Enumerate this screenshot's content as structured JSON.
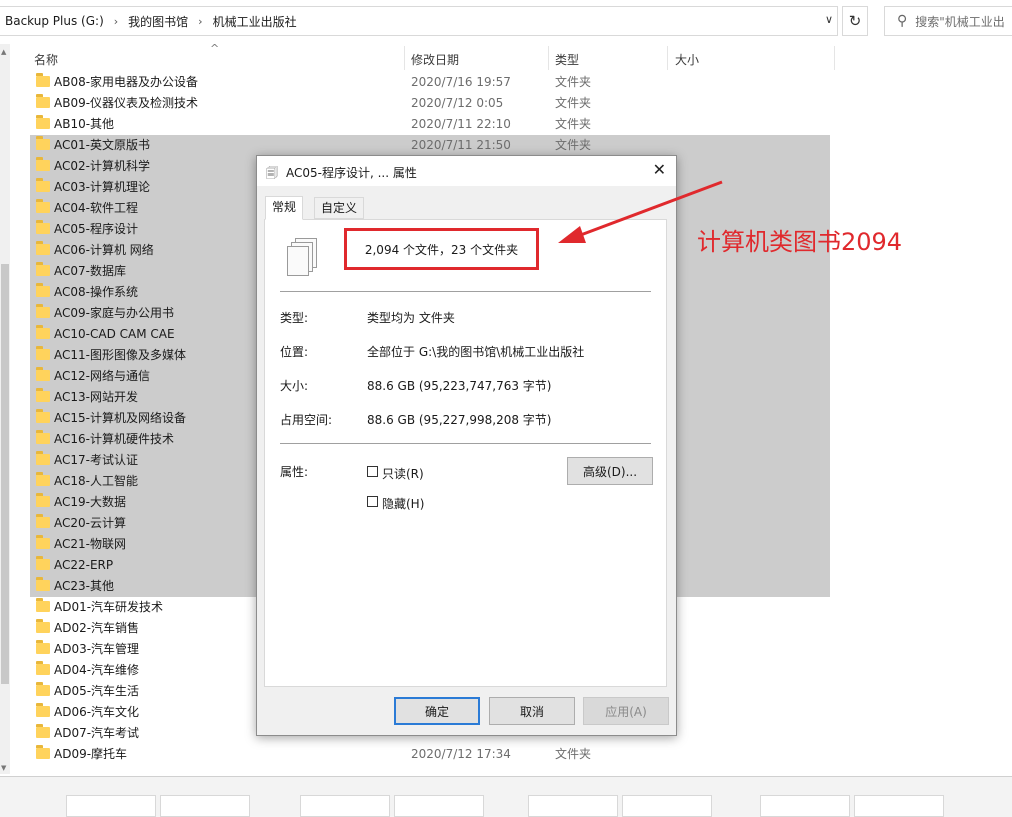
{
  "address": {
    "crumbs": [
      "Backup Plus (G:)",
      "我的图书馆",
      "机械工业出版社"
    ],
    "search_placeholder": "搜索\"机械工业出"
  },
  "columns": {
    "name": "名称",
    "date": "修改日期",
    "type": "类型",
    "size": "大小"
  },
  "files": [
    {
      "name": "AB08-家用电器及办公设备",
      "date": "2020/7/16 19:57",
      "type": "文件夹",
      "selected": false
    },
    {
      "name": "AB09-仪器仪表及检测技术",
      "date": "2020/7/12 0:05",
      "type": "文件夹",
      "selected": false
    },
    {
      "name": "AB10-其他",
      "date": "2020/7/11 22:10",
      "type": "文件夹",
      "selected": false
    },
    {
      "name": "AC01-英文原版书",
      "date": "2020/7/11 21:50",
      "type": "文件夹",
      "selected": true
    },
    {
      "name": "AC02-计算机科学",
      "date": "",
      "type": "",
      "selected": true
    },
    {
      "name": "AC03-计算机理论",
      "date": "",
      "type": "",
      "selected": true
    },
    {
      "name": "AC04-软件工程",
      "date": "",
      "type": "",
      "selected": true
    },
    {
      "name": "AC05-程序设计",
      "date": "",
      "type": "",
      "selected": true
    },
    {
      "name": "AC06-计算机 网络",
      "date": "",
      "type": "",
      "selected": true
    },
    {
      "name": "AC07-数据库",
      "date": "",
      "type": "",
      "selected": true
    },
    {
      "name": "AC08-操作系统",
      "date": "",
      "type": "",
      "selected": true
    },
    {
      "name": "AC09-家庭与办公用书",
      "date": "",
      "type": "",
      "selected": true
    },
    {
      "name": "AC10-CAD CAM CAE",
      "date": "",
      "type": "",
      "selected": true
    },
    {
      "name": "AC11-图形图像及多媒体",
      "date": "",
      "type": "",
      "selected": true
    },
    {
      "name": "AC12-网络与通信",
      "date": "",
      "type": "",
      "selected": true
    },
    {
      "name": "AC13-网站开发",
      "date": "",
      "type": "",
      "selected": true
    },
    {
      "name": "AC15-计算机及网络设备",
      "date": "",
      "type": "",
      "selected": true
    },
    {
      "name": "AC16-计算机硬件技术",
      "date": "",
      "type": "",
      "selected": true
    },
    {
      "name": "AC17-考试认证",
      "date": "",
      "type": "",
      "selected": true
    },
    {
      "name": "AC18-人工智能",
      "date": "",
      "type": "",
      "selected": true
    },
    {
      "name": "AC19-大数据",
      "date": "",
      "type": "",
      "selected": true
    },
    {
      "name": "AC20-云计算",
      "date": "",
      "type": "",
      "selected": true
    },
    {
      "name": "AC21-物联网",
      "date": "",
      "type": "",
      "selected": true
    },
    {
      "name": "AC22-ERP",
      "date": "",
      "type": "",
      "selected": true
    },
    {
      "name": "AC23-其他",
      "date": "",
      "type": "",
      "selected": true
    },
    {
      "name": "AD01-汽车研发技术",
      "date": "",
      "type": "",
      "selected": false
    },
    {
      "name": "AD02-汽车销售",
      "date": "",
      "type": "",
      "selected": false
    },
    {
      "name": "AD03-汽车管理",
      "date": "",
      "type": "",
      "selected": false
    },
    {
      "name": "AD04-汽车维修",
      "date": "",
      "type": "",
      "selected": false
    },
    {
      "name": "AD05-汽车生活",
      "date": "",
      "type": "",
      "selected": false
    },
    {
      "name": "AD06-汽车文化",
      "date": "",
      "type": "",
      "selected": false
    },
    {
      "name": "AD07-汽车考试",
      "date": "",
      "type": "",
      "selected": false
    },
    {
      "name": "AD09-摩托车",
      "date": "2020/7/12 17:34",
      "type": "文件夹",
      "selected": false
    }
  ],
  "dialog": {
    "title": "AC05-程序设计, ... 属性",
    "tabs": [
      "常规",
      "自定义"
    ],
    "summary": "2,094 个文件，23 个文件夹",
    "props": [
      {
        "label": "类型:",
        "value": "类型均为 文件夹"
      },
      {
        "label": "位置:",
        "value": "全部位于 G:\\我的图书馆\\机械工业出版社"
      },
      {
        "label": "大小:",
        "value": "88.6 GB (95,223,747,763 字节)"
      },
      {
        "label": "占用空间:",
        "value": "88.6 GB (95,227,998,208 字节)"
      }
    ],
    "attr_label": "属性:",
    "readonly_label": "只读(R)",
    "hidden_label": "隐藏(H)",
    "advanced_label": "高级(D)...",
    "ok": "确定",
    "cancel": "取消",
    "apply": "应用(A)"
  },
  "annotation": {
    "text": "计算机类图书2094",
    "color": "#e0292d"
  },
  "colors": {
    "selection": "#cccccc",
    "folder": "#ffd35c",
    "accent": "#2b7bd6"
  }
}
